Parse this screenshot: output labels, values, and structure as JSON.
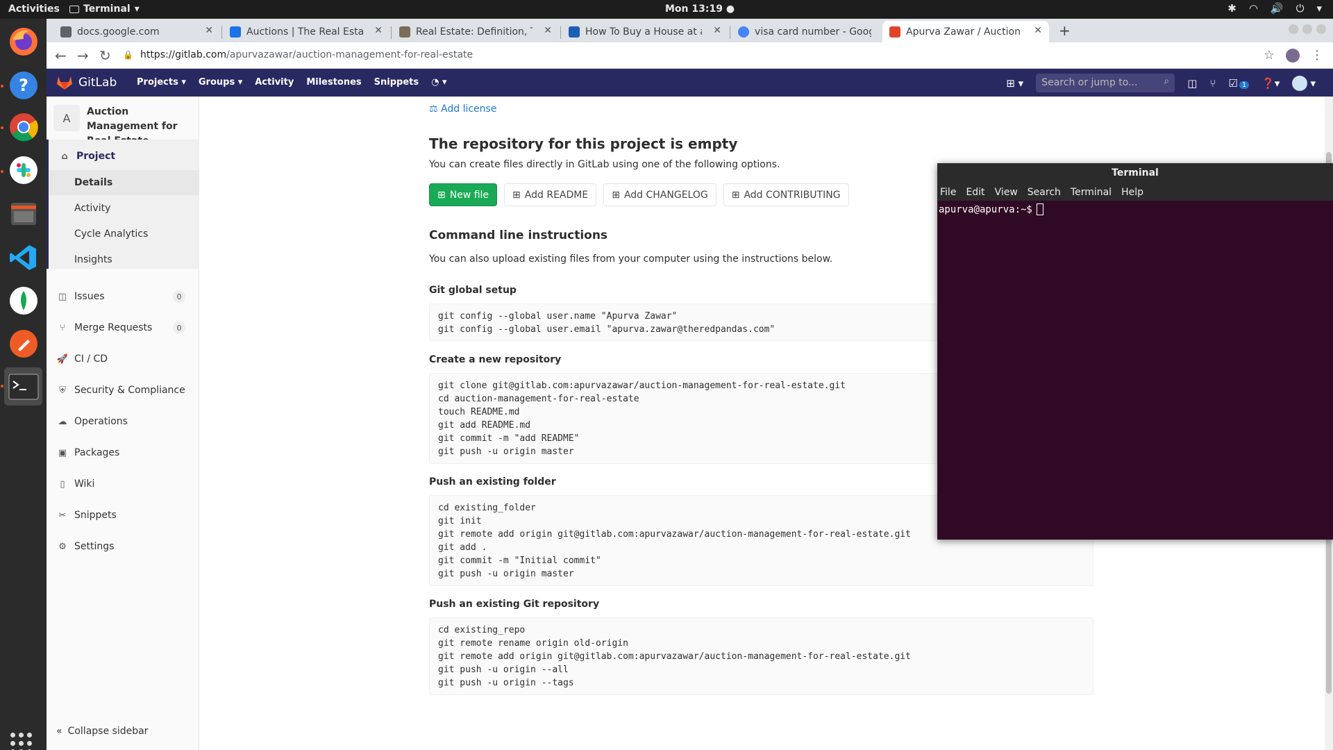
{
  "top_panel": {
    "activities": "Activities",
    "app_name": "Terminal",
    "clock": "Mon 13:19"
  },
  "browser": {
    "tabs": [
      {
        "title": "docs.google.com",
        "favicon_color": "#5f6368"
      },
      {
        "title": "Auctions | The Real Estate",
        "favicon_color": "#1a73e8"
      },
      {
        "title": "Real Estate: Definition, Ty",
        "favicon_color": "#7a6e5a"
      },
      {
        "title": "How To Buy a House at a",
        "favicon_color": "#1a5fb4"
      },
      {
        "title": "visa card number - Google",
        "favicon_color": "#4285f4"
      },
      {
        "title": "Apurva Zawar / Auction M",
        "favicon_color": "#e24329"
      }
    ],
    "url_host": "https://gitlab.com",
    "url_path": "/apurvazawar/auction-management-for-real-estate"
  },
  "gitlab_nav": {
    "brand": "GitLab",
    "menu": [
      "Projects",
      "Groups",
      "Activity",
      "Milestones",
      "Snippets"
    ],
    "search_placeholder": "Search or jump to...",
    "todo_count": "1"
  },
  "sidebar": {
    "project_avatar": "A",
    "project_name": "Auction Management for Real Estate",
    "project_label": "Project",
    "project_sub": [
      "Details",
      "Activity",
      "Cycle Analytics",
      "Insights"
    ],
    "items": [
      {
        "label": "Issues",
        "badge": "0",
        "icon": "issues-icon"
      },
      {
        "label": "Merge Requests",
        "badge": "0",
        "icon": "merge-icon"
      },
      {
        "label": "CI / CD",
        "icon": "rocket-icon"
      },
      {
        "label": "Security & Compliance",
        "icon": "shield-icon"
      },
      {
        "label": "Operations",
        "icon": "cloud-icon"
      },
      {
        "label": "Packages",
        "icon": "package-icon"
      },
      {
        "label": "Wiki",
        "icon": "book-icon"
      },
      {
        "label": "Snippets",
        "icon": "scissors-icon"
      },
      {
        "label": "Settings",
        "icon": "gear-icon"
      }
    ],
    "collapse": "Collapse sidebar"
  },
  "main": {
    "add_license": "Add license",
    "empty_title": "The repository for this project is empty",
    "empty_desc": "You can create files directly in GitLab using one of the following options.",
    "buttons": {
      "new_file": "New file",
      "readme": "Add README",
      "changelog": "Add CHANGELOG",
      "contributing": "Add CONTRIBUTING"
    },
    "cli_title": "Command line instructions",
    "cli_desc": "You can also upload existing files from your computer using the instructions below.",
    "sections": [
      {
        "title": "Git global setup",
        "code": "git config --global user.name \"Apurva Zawar\"\ngit config --global user.email \"apurva.zawar@theredpandas.com\""
      },
      {
        "title": "Create a new repository",
        "code": "git clone git@gitlab.com:apurvazawar/auction-management-for-real-estate.git\ncd auction-management-for-real-estate\ntouch README.md\ngit add README.md\ngit commit -m \"add README\"\ngit push -u origin master"
      },
      {
        "title": "Push an existing folder",
        "code": "cd existing_folder\ngit init\ngit remote add origin git@gitlab.com:apurvazawar/auction-management-for-real-estate.git\ngit add .\ngit commit -m \"Initial commit\"\ngit push -u origin master"
      },
      {
        "title": "Push an existing Git repository",
        "code": "cd existing_repo\ngit remote rename origin old-origin\ngit remote add origin git@gitlab.com:apurvazawar/auction-management-for-real-estate.git\ngit push -u origin --all\ngit push -u origin --tags"
      }
    ]
  },
  "terminal": {
    "title": "Terminal",
    "menu": [
      "File",
      "Edit",
      "View",
      "Search",
      "Terminal",
      "Help"
    ],
    "prompt": "apurva@apurva:~$"
  }
}
